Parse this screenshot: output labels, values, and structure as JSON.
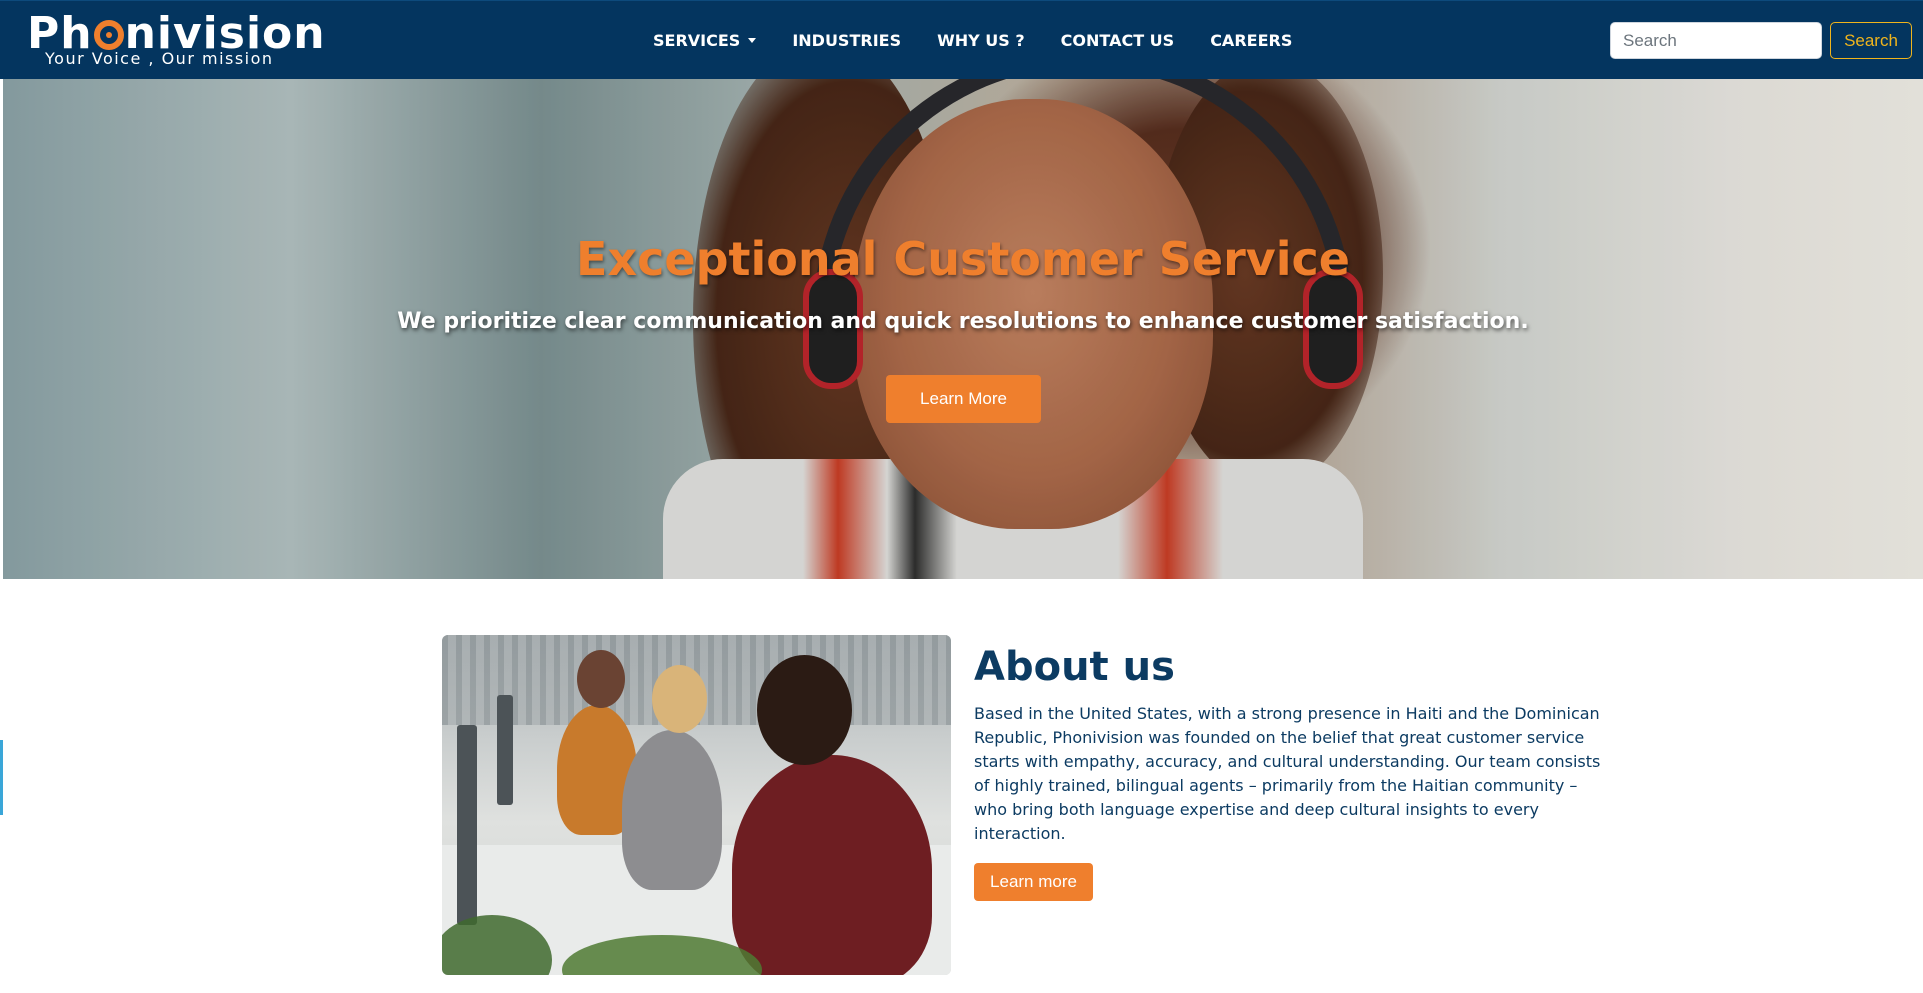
{
  "brand": {
    "logo_prefix": "Ph",
    "logo_suffix": "nivision",
    "tagline": "Your Voice , Our mission",
    "accent_color": "#ef7f2d",
    "navbar_color": "#04355f"
  },
  "nav": {
    "items": [
      {
        "label": "SERVICES",
        "has_dropdown": true
      },
      {
        "label": "INDUSTRIES",
        "has_dropdown": false
      },
      {
        "label": "WHY US ?",
        "has_dropdown": false
      },
      {
        "label": "CONTACT US",
        "has_dropdown": false
      },
      {
        "label": "CAREERS",
        "has_dropdown": false
      }
    ],
    "search": {
      "placeholder": "Search",
      "button_label": "Search"
    }
  },
  "hero": {
    "title": "Exceptional Customer Service",
    "subtitle": "We prioritize clear communication and quick resolutions to enhance customer satisfaction.",
    "button_label": "Learn More"
  },
  "about": {
    "title": "About us",
    "text": "Based in the United States, with a strong presence in Haiti and the Dominican Republic, Phonivision was founded on the belief that great customer service starts with empathy, accuracy, and cultural understanding. Our team consists of highly trained, bilingual agents – primarily from the Haitian community – who bring both language expertise and deep cultural insights to every interaction.",
    "button_label": "Learn more"
  }
}
